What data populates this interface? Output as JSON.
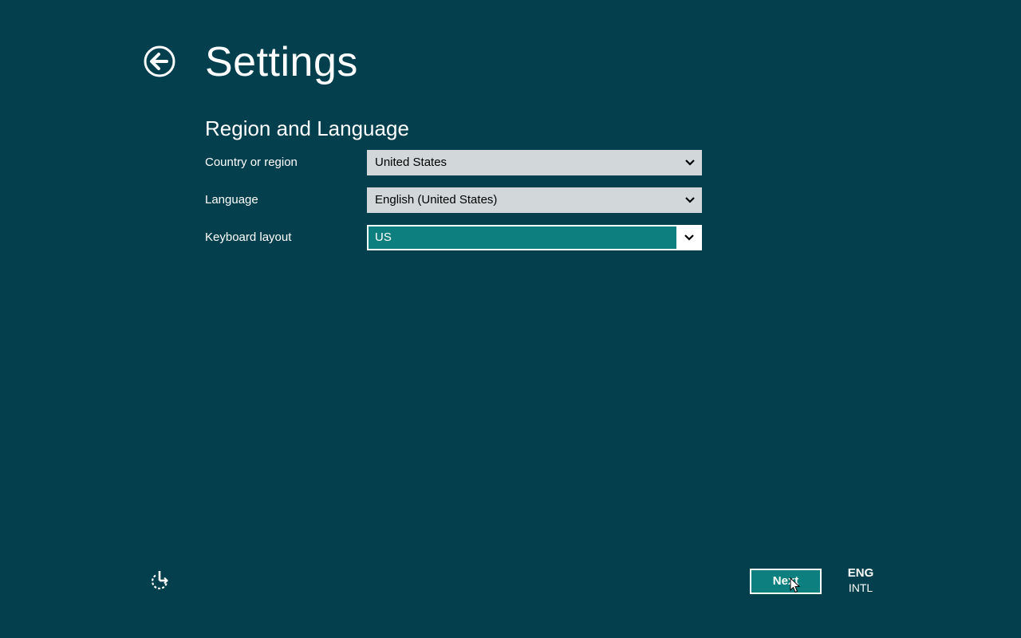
{
  "header": {
    "title": "Settings"
  },
  "section": {
    "title": "Region and Language"
  },
  "fields": [
    {
      "label": "Country or region",
      "value": "United States"
    },
    {
      "label": "Language",
      "value": "English (United States)"
    },
    {
      "label": "Keyboard layout",
      "value": "US"
    }
  ],
  "footer": {
    "next_label": "Next",
    "input_language": "ENG",
    "input_layout": "INTL"
  },
  "icons": {
    "back": "back-arrow-circle-icon",
    "ease_of_access": "ease-of-access-icon",
    "dropdown": "chevron-down-icon",
    "cursor": "mouse-pointer-icon"
  },
  "colors": {
    "background": "#033f4d",
    "accent": "#0e7f7f",
    "select_background": "#d2d8da",
    "text": "#ffffff"
  }
}
